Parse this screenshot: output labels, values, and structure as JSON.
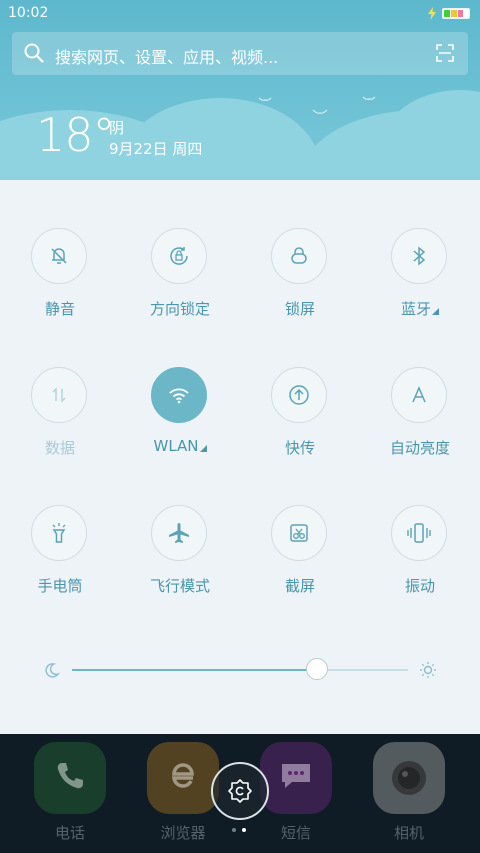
{
  "status_bar": {
    "time": "10:02"
  },
  "search": {
    "placeholder": "搜索网页、设置、应用、视频..."
  },
  "weather": {
    "temperature": "18°",
    "condition": "阴",
    "date": "9月22日 周四"
  },
  "toggles": [
    {
      "label": "静音",
      "icon": "bell-off-icon",
      "active": false,
      "dim": false
    },
    {
      "label": "方向锁定",
      "icon": "rotation-lock-icon",
      "active": false,
      "dim": false
    },
    {
      "label": "锁屏",
      "icon": "lock-icon",
      "active": false,
      "dim": false
    },
    {
      "label": "蓝牙",
      "icon": "bluetooth-icon",
      "active": false,
      "dim": false,
      "has_more": true
    },
    {
      "label": "数据",
      "icon": "mobile-data-icon",
      "active": false,
      "dim": true
    },
    {
      "label": "WLAN",
      "icon": "wifi-icon",
      "active": true,
      "dim": false,
      "has_more": true
    },
    {
      "label": "快传",
      "icon": "quick-transfer-icon",
      "active": false,
      "dim": false
    },
    {
      "label": "自动亮度",
      "icon": "auto-brightness-icon",
      "active": false,
      "dim": false
    },
    {
      "label": "手电筒",
      "icon": "flashlight-icon",
      "active": false,
      "dim": false
    },
    {
      "label": "飞行模式",
      "icon": "airplane-icon",
      "active": false,
      "dim": false
    },
    {
      "label": "截屏",
      "icon": "screenshot-icon",
      "active": false,
      "dim": false
    },
    {
      "label": "振动",
      "icon": "vibrate-icon",
      "active": false,
      "dim": false
    }
  ],
  "brightness": {
    "value": 0.73
  },
  "dock": [
    {
      "label": "电话",
      "icon": "phone-icon",
      "color": "#2f7d3a"
    },
    {
      "label": "浏览器",
      "icon": "browser-icon",
      "color": "#d08a1a"
    },
    {
      "label": "短信",
      "icon": "message-icon",
      "color": "#8a2a9a"
    },
    {
      "label": "相机",
      "icon": "camera-icon",
      "color": "#9a9a9a"
    }
  ],
  "colors": {
    "accent": "#6bb7c8",
    "label": "#4a96ad",
    "panel": "#edf3f6"
  }
}
